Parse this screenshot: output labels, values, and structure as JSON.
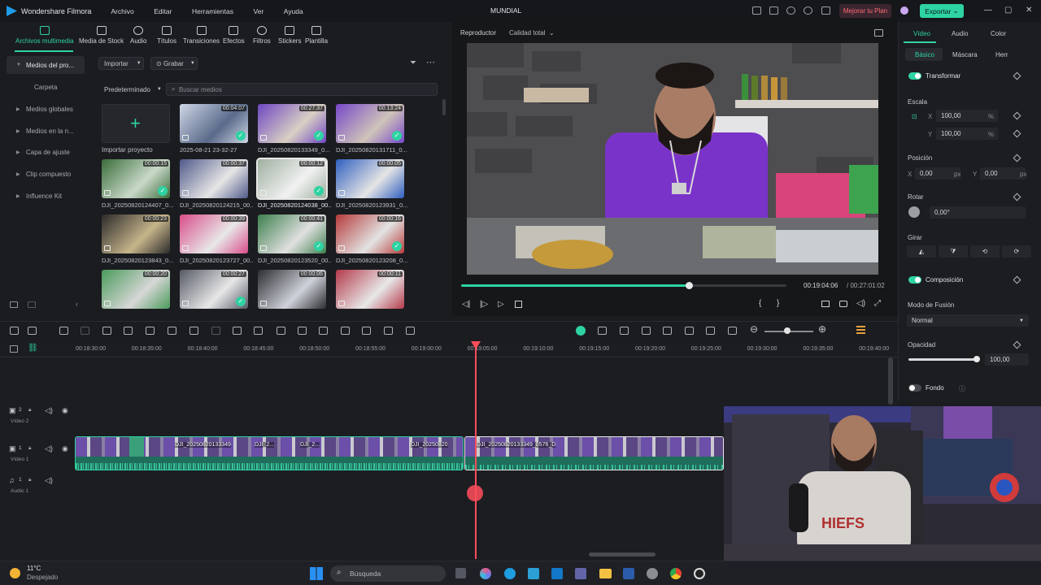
{
  "app": {
    "name": "Wondershare Filmora",
    "project": "MUNDIAL",
    "upgrade": "Mejorar tu Plan",
    "export": "Exportar"
  },
  "menu": [
    "Archivo",
    "Editar",
    "Herramientas",
    "Ver",
    "Ayuda"
  ],
  "mediaTabs": [
    "Archivos multimedia",
    "Media de Stock",
    "Audio",
    "Títulos",
    "Transiciones",
    "Efectos",
    "Filtros",
    "Stickers",
    "Plantilla"
  ],
  "sidebar": [
    "Medios del pro...",
    "Carpeta",
    "Medios globales",
    "Medios en la n...",
    "Capa de ajuste",
    "Clip compuesto",
    "Influence Kit"
  ],
  "media": {
    "import": "Importar",
    "record": "Grabar",
    "sort": "Predeterminado",
    "search_placeholder": "Buscar medios",
    "import_project": "Importar proyecto"
  },
  "thumbs": [
    {
      "dur": "00:04:07",
      "label": "2025-08-21 23-32-27"
    },
    {
      "dur": "00:27:37",
      "label": "DJI_20250820133349_0..."
    },
    {
      "dur": "00:13:24",
      "label": "DJI_20250820131711_0..."
    },
    {
      "dur": "00:00:15",
      "label": "DJI_20250820124407_0..."
    },
    {
      "dur": "00:00:37",
      "label": "DJI_20250820124215_00..."
    },
    {
      "dur": "00:00:12",
      "label": "DJI_20250820124038_00..."
    },
    {
      "dur": "00:00:05",
      "label": "DJI_20250820123931_0..."
    },
    {
      "dur": "00:00:23",
      "label": "DJI_20250820123843_0..."
    },
    {
      "dur": "00:00:39",
      "label": "DJI_20250820123727_00..."
    },
    {
      "dur": "00:00:41",
      "label": "DJI_20250820123520_00..."
    },
    {
      "dur": "00:00:16",
      "label": "DJI_20250820123208_0..."
    },
    {
      "dur": "00:00:20",
      "label": ""
    },
    {
      "dur": "00:00:27",
      "label": ""
    },
    {
      "dur": "00:00:06",
      "label": ""
    },
    {
      "dur": "00:00:11",
      "label": ""
    }
  ],
  "player": {
    "label": "Reproductor",
    "quality": "Calidad total",
    "current": "00:19:04:06",
    "total": "/ 00:27:01:02",
    "progress": 0.7
  },
  "right": {
    "tabs": [
      "Vídeo",
      "Audio",
      "Color"
    ],
    "subtabs": [
      "Básico",
      "Máscara",
      "Herr"
    ],
    "transform": "Transformar",
    "scale": "Escala",
    "x": "X",
    "y": "Y",
    "scale_x": "100,00",
    "scale_y": "100,00",
    "pct": "%",
    "position": "Posición",
    "pos_x": "0,00",
    "pos_y": "0,00",
    "px": "px",
    "rotate": "Rotar",
    "rot": "0,00°",
    "flip": "Girar",
    "composition": "Composición",
    "blend": "Modo de Fusión",
    "blend_val": "Normal",
    "opacity": "Opacidad",
    "opacity_val": "100,00",
    "background": "Fondo"
  },
  "ruler": [
    "00:18:30:00",
    "00:18:35:00",
    "00:18:40:00",
    "00:18:45:00",
    "00:18:50:00",
    "00:18:55:00",
    "00:19:00:00",
    "00:19:05:00",
    "00:19:10:00",
    "00:19:15:00",
    "00:19:20:00",
    "00:19:25:00",
    "00:19:30:00",
    "00:19:35:00",
    "00:19:40:00"
  ],
  "tracks": {
    "v2": "Vídeo 2",
    "v1": "Vídeo 1",
    "a1": "Audio 1",
    "n2": "2",
    "n1": "1",
    "na": "1"
  },
  "clips": [
    "DJI_20250820133349",
    "DJI_2...",
    "DJI_2...",
    "DJI_20250820",
    "DJI_20250820133349_0576_D"
  ],
  "taskbar": {
    "temp": "11°C",
    "weather": "Despejado",
    "search": "Búsqueda"
  }
}
